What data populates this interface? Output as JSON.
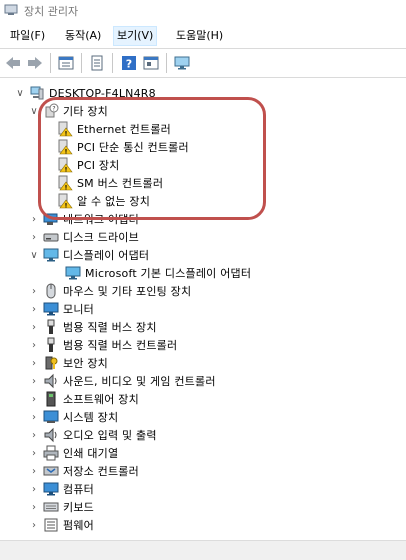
{
  "window": {
    "title": "장치 관리자"
  },
  "menu": [
    "파일(F)",
    "동작(A)",
    "보기(V)",
    "도움말(H)"
  ],
  "tree": {
    "root": "DESKTOP-F4LN4R8",
    "other_devices": {
      "label": "기타 장치",
      "children": [
        "Ethernet 컨트롤러",
        "PCI 단순 통신 컨트롤러",
        "PCI 장치",
        "SM 버스 컨트롤러",
        "알 수 없는 장치"
      ]
    },
    "categories_a": [
      "네트워크 어댑터",
      "디스크 드라이브"
    ],
    "display": {
      "label": "디스플레이 어댑터",
      "child": "Microsoft 기본 디스플레이 어댑터"
    },
    "categories_b": [
      "마우스 및 기타 포인팅 장치",
      "모니터",
      "범용 직렬 버스 장치",
      "범용 직렬 버스 컨트롤러",
      "보안 장치",
      "사운드, 비디오 및 게임 컨트롤러",
      "소프트웨어 장치",
      "시스템 장치",
      "오디오 입력 및 출력",
      "인쇄 대기열",
      "저장소 컨트롤러",
      "컴퓨터",
      "키보드",
      "펌웨어"
    ]
  }
}
